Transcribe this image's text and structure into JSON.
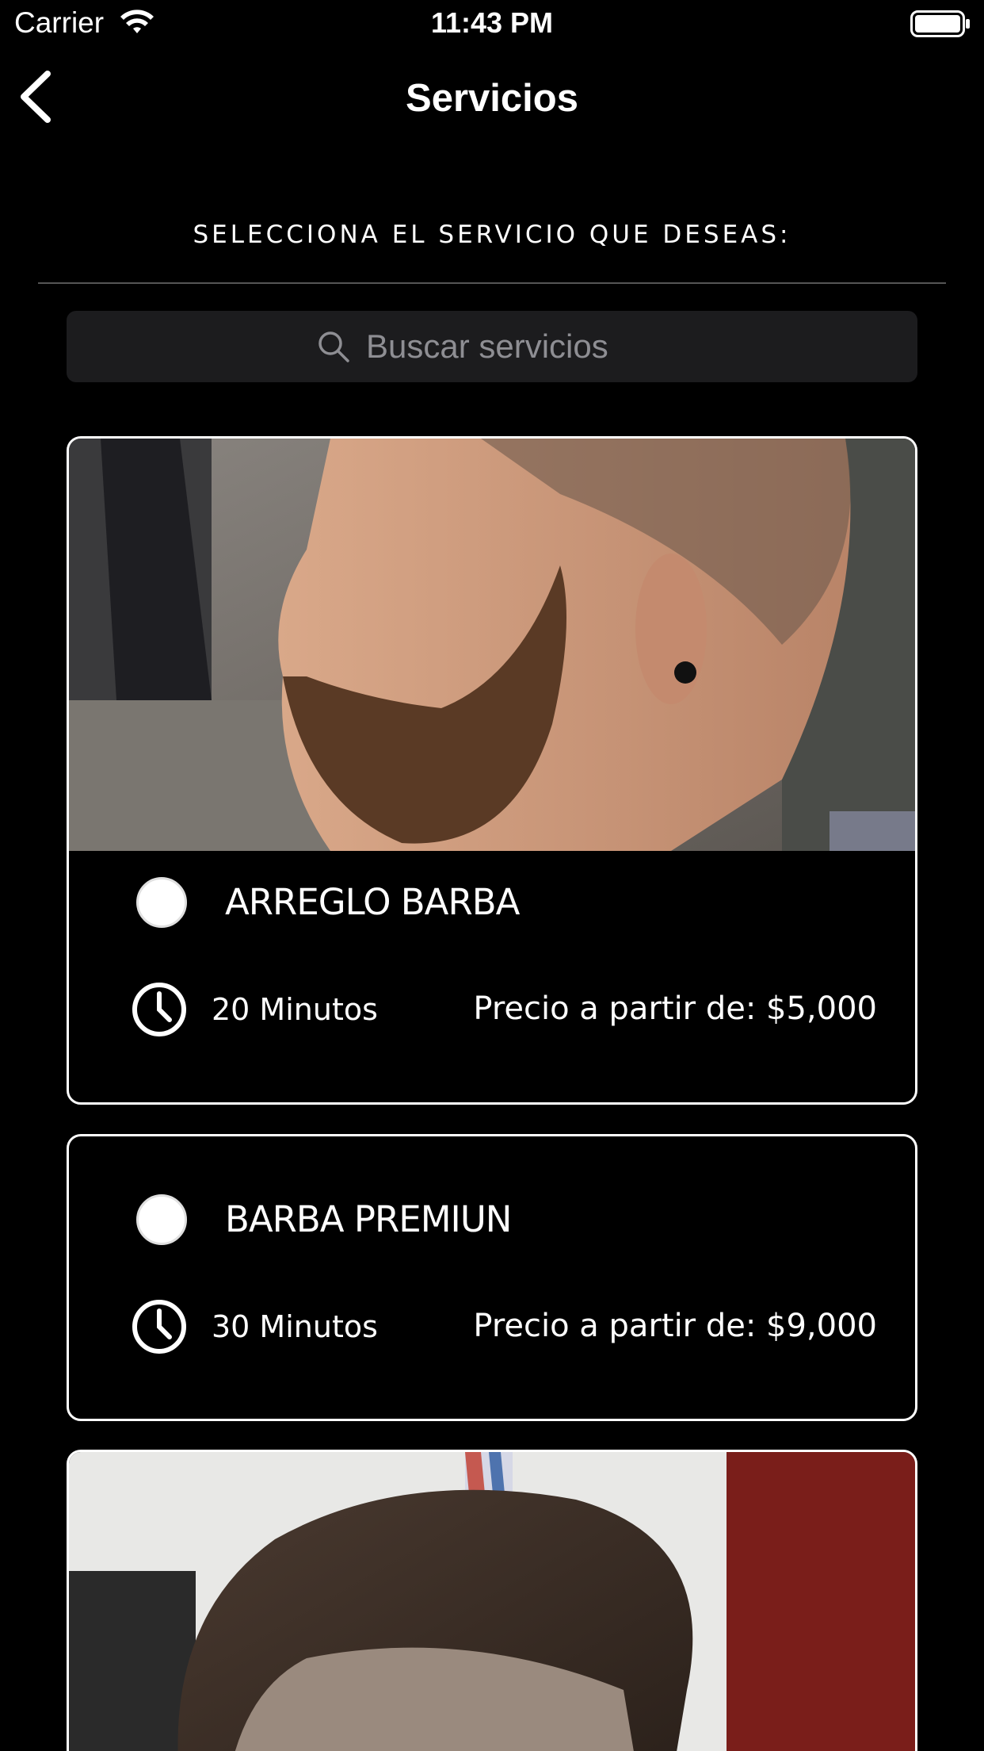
{
  "status_bar": {
    "carrier": "Carrier",
    "time": "11:43 PM"
  },
  "nav": {
    "title": "Servicios"
  },
  "section_title": "SELECCIONA EL SERVICIO QUE DESEAS:",
  "search": {
    "placeholder": "Buscar servicios",
    "value": ""
  },
  "services": [
    {
      "name": "ARREGLO BARBA",
      "duration": "20 Minutos",
      "price": "Precio a partir de: $5,000",
      "has_image": true,
      "selected": false
    },
    {
      "name": "BARBA PREMIUN",
      "duration": "30 Minutos",
      "price": "Precio a partir de: $9,000",
      "has_image": false,
      "selected": false
    },
    {
      "name": "",
      "duration": "",
      "price": "",
      "has_image": true,
      "selected": false
    }
  ],
  "colors": {
    "background": "#000000",
    "text": "#ffffff",
    "search_bg": "#1c1c1e",
    "placeholder": "#8e8e93",
    "card_border": "#ffffff"
  }
}
